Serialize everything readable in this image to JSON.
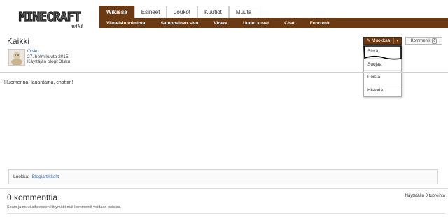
{
  "header": {
    "logo_text": "MINECRAFT",
    "logo_sub": "wiki"
  },
  "nav": {
    "tabs": [
      {
        "label": "Wikissä",
        "active": true
      },
      {
        "label": "Esineet"
      },
      {
        "label": "Joukot"
      },
      {
        "label": "Kuutiot"
      },
      {
        "label": "Muuta"
      }
    ],
    "sub_items": [
      "Viimeisin toiminta",
      "Satunnainen sivu",
      "Videot",
      "Uudet kuvat",
      "Chat",
      "Foorumit"
    ]
  },
  "post": {
    "title": "Kaikki",
    "author": "Olsku",
    "date": "27. helmikuuta 2015",
    "blog": "Käyttäjän blogi:Olsku",
    "body": "Huomenna, lauantaina, chattiin!"
  },
  "actions": {
    "edit_label": "Muokkaa",
    "comments_label": "Kommentit",
    "comments_count": "0",
    "menu_items": [
      "Siirrä",
      "Suojaa",
      "Poista",
      "Historia"
    ]
  },
  "category": {
    "label": "Luokka:",
    "value": "Blogiartikkelit"
  },
  "comments": {
    "title": "0 kommenttia",
    "showing": "Näytetään 0 tuoreinta",
    "spam_note": "Spam ja muut aiheeseen liittymättömät kommentit voidaan poistaa."
  },
  "colors": {
    "brand_brown": "#6b3a12",
    "link_blue": "#3366aa"
  }
}
